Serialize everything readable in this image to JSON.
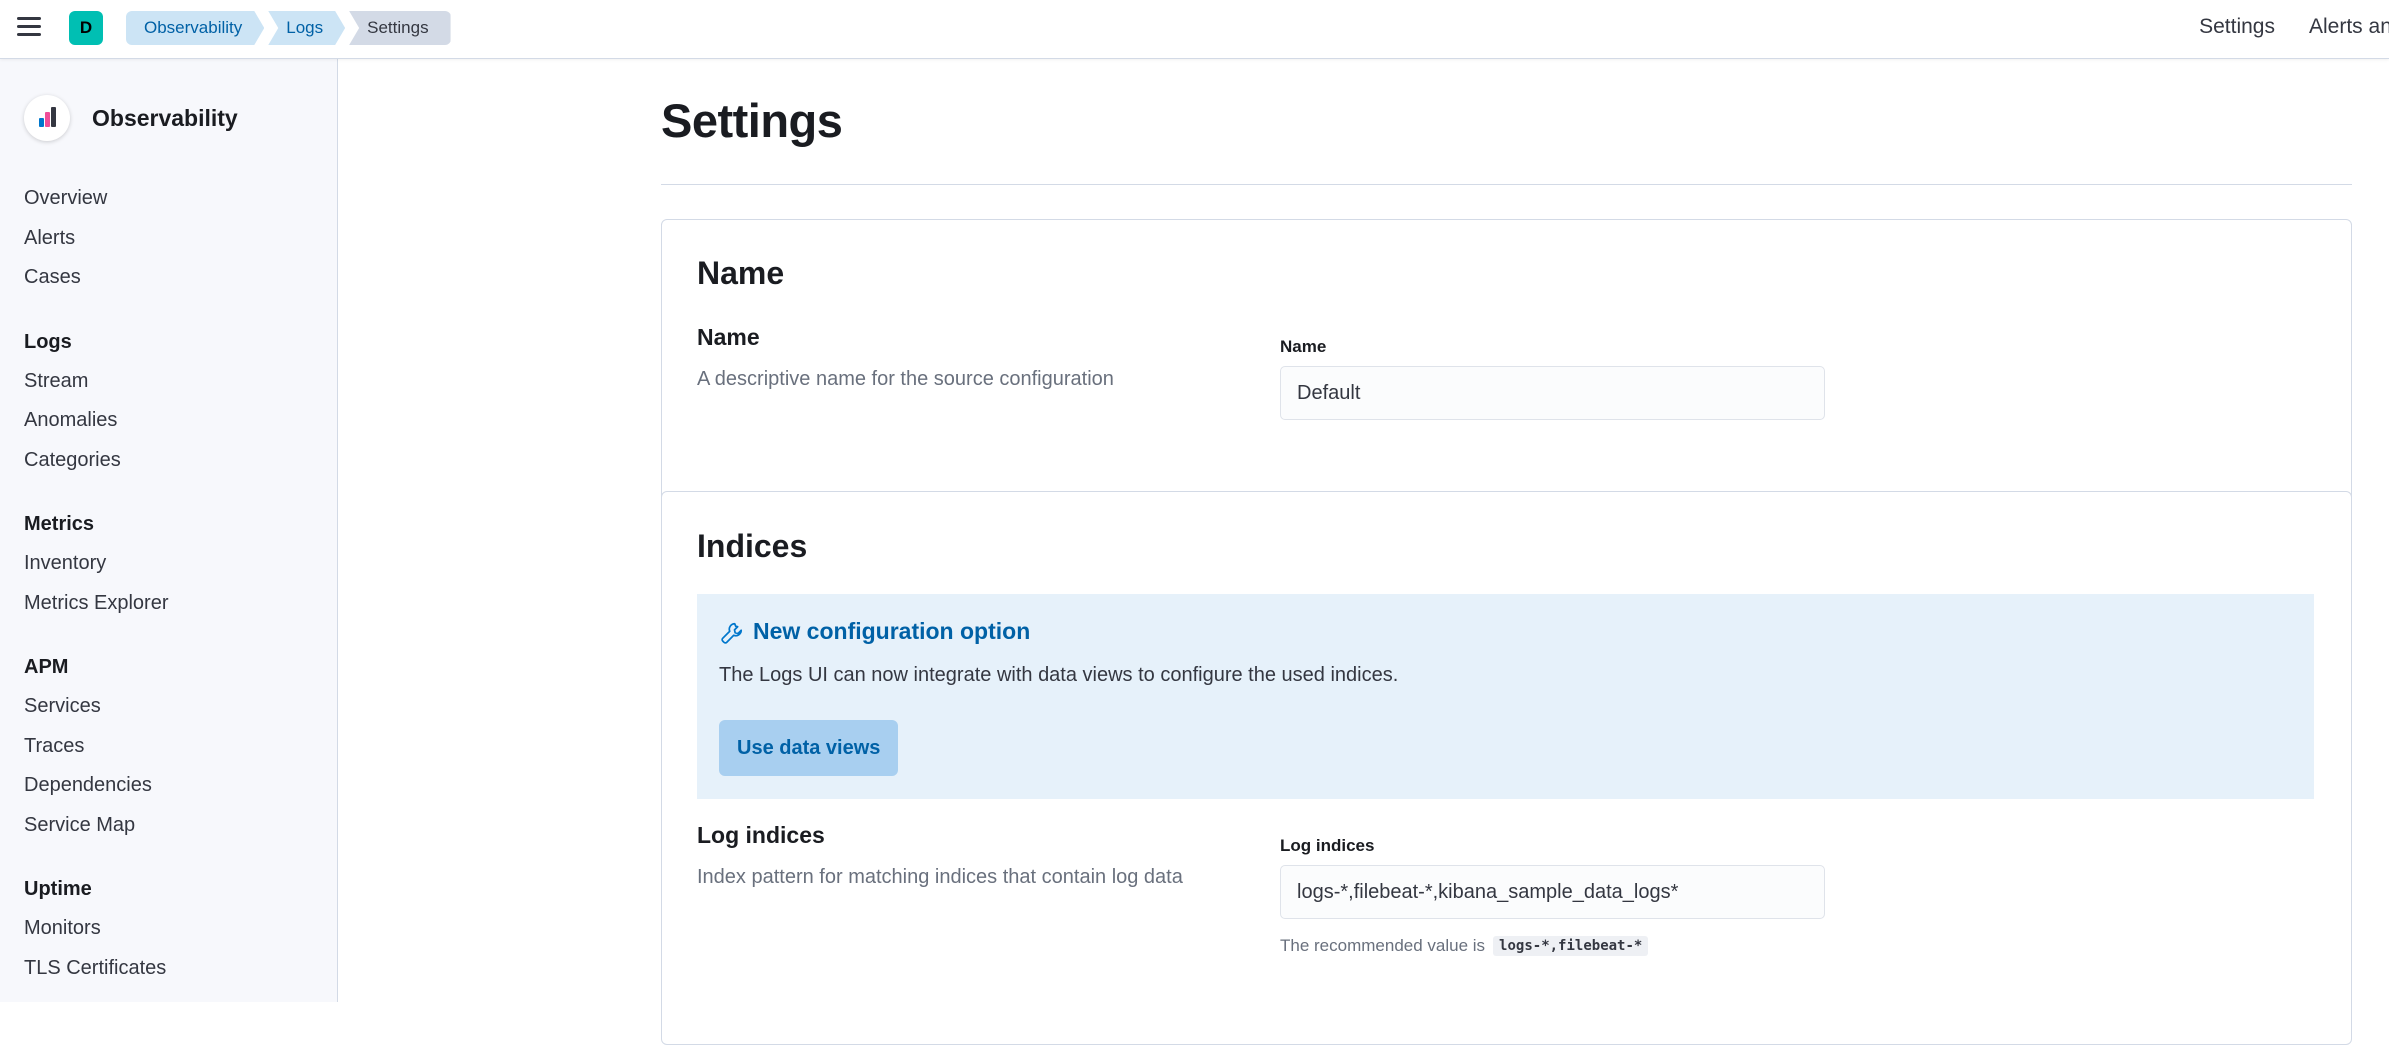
{
  "header": {
    "space_initial": "D",
    "breadcrumbs": [
      "Observability",
      "Logs",
      "Settings"
    ],
    "links": [
      "Settings",
      "Alerts and rules"
    ]
  },
  "sidebar": {
    "title": "Observability",
    "groups": [
      {
        "title": "",
        "items": [
          "Overview",
          "Alerts",
          "Cases"
        ]
      },
      {
        "title": "Logs",
        "items": [
          "Stream",
          "Anomalies",
          "Categories"
        ]
      },
      {
        "title": "Metrics",
        "items": [
          "Inventory",
          "Metrics Explorer"
        ]
      },
      {
        "title": "APM",
        "items": [
          "Services",
          "Traces",
          "Dependencies",
          "Service Map"
        ]
      },
      {
        "title": "Uptime",
        "items": [
          "Monitors",
          "TLS Certificates"
        ]
      }
    ]
  },
  "main": {
    "title": "Settings",
    "name_panel": {
      "heading": "Name",
      "field_title": "Name",
      "field_description": "A descriptive name for the source configuration",
      "field_label": "Name",
      "field_value": "Default"
    },
    "indices_panel": {
      "heading": "Indices",
      "callout": {
        "title": "New configuration option",
        "text": "The Logs UI can now integrate with data views to configure the used indices.",
        "button": "Use data views"
      },
      "field_title": "Log indices",
      "field_description": "Index pattern for matching indices that contain log data",
      "field_label": "Log indices",
      "field_value": "logs-*,filebeat-*,kibana_sample_data_logs*",
      "help_prefix": "The recommended value is",
      "help_code": "logs-*,filebeat-*"
    }
  },
  "colors": {
    "accent": "#0077cc",
    "link": "#0061a6",
    "breadcrumb_bg": "#cce4f5",
    "callout_bg": "#e6f1fa",
    "space_avatar": "#00bfb3"
  },
  "icons": {
    "menu": "hamburger-icon",
    "observability_logo": "observability-logo-icon",
    "callout": "wrench-icon"
  }
}
